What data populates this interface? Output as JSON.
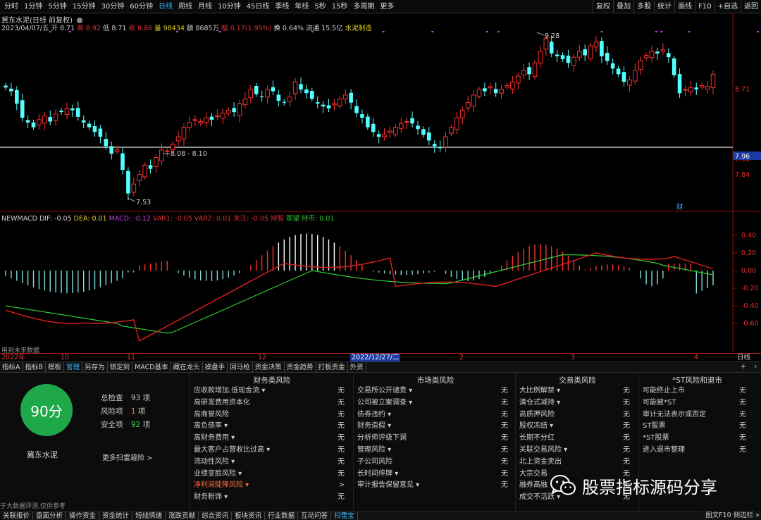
{
  "toolbar": {
    "tabs": [
      "分时",
      "1分钟",
      "5分钟",
      "15分钟",
      "30分钟",
      "60分钟",
      "日线",
      "周线",
      "月线",
      "10分钟",
      "45日线",
      "季线",
      "年线",
      "5秒",
      "15秒",
      "多周期",
      "更多"
    ],
    "active_tab": "日线",
    "right": [
      "复权",
      "叠加",
      "多股",
      "统计",
      "画线",
      "F10",
      "+自选",
      "返回"
    ]
  },
  "header": {
    "title": "冀东水泥(日线 前复权)",
    "date": "2023/04/07/五",
    "open_label": "开",
    "open": "8.71",
    "high_label": "高",
    "high": "8.92",
    "low_label": "低",
    "low": "8.71",
    "close_label": "收",
    "close": "8.86",
    "volume_label": "量",
    "volume": "98434",
    "amount_label": "额",
    "amount": "8685万",
    "change_label": "幅",
    "change": "0.17(1.95%)",
    "turnover_label": "换",
    "turnover": "0.64%",
    "float_label": "流通",
    "float": "15.5亿",
    "industry": "水泥制造"
  },
  "kchart": {
    "price_labels": [
      "8.71",
      "7.96",
      "7.84"
    ],
    "current_price": "7.96",
    "high_mark": "9.28",
    "low_mark": "7.53",
    "range_mark": "8.08 - 8.10",
    "fin_marker": "财"
  },
  "macd": {
    "name": "NEWMACD",
    "dif_label": "DIF:",
    "dif": "-0.05",
    "dea_label": "DEA:",
    "dea": "0.01",
    "macd_label": "MACD:",
    "macd": "-0.12",
    "var1_label": "VAR1:",
    "var1": "-0.05",
    "var2_label": "VAR2:",
    "var2": "0.01",
    "focus_label": "关注:",
    "focus": "-0.05",
    "hold_label": "持股",
    "watch_label": "观望",
    "cash_label": "持币:",
    "cash": "0.01",
    "axis": [
      "0.40",
      "0.20",
      "0.00",
      "-0.20",
      "-0.40",
      "-0.60"
    ],
    "footnote": "用到未来数据"
  },
  "dateaxis": {
    "labels": [
      "2022年",
      "10",
      "11",
      "12",
      "2022/12/27/二",
      "2",
      "3",
      "4"
    ],
    "right_label": "日线"
  },
  "indicator_tabs": [
    "指标A",
    "指标B",
    "模板",
    "管理",
    "另存为",
    "锁定到",
    "MACD基本",
    "藏在龙头",
    "操盘手",
    "回马枪",
    "资金决策",
    "资金趋势",
    "打板资金",
    "外资"
  ],
  "indicator_active": "管理",
  "score": {
    "value": "90分",
    "total_label": "总检查",
    "total": "93",
    "total_unit": "项",
    "risk_label": "风险项",
    "risk": "1",
    "risk_unit": "项",
    "safe_label": "安全项",
    "safe": "92",
    "safe_unit": "项",
    "company": "冀东水泥",
    "more": "更多扫雷避险 >",
    "footnote": "于大数据评测,仅供参考",
    "color": "#1fa84a"
  },
  "risk_columns": [
    {
      "title": "财务类风险",
      "rows": [
        {
          "k": "应收款增加,低现金流 ▾",
          "v": "无"
        },
        {
          "k": "高研发费用资本化",
          "v": "无"
        },
        {
          "k": "高商誉风险",
          "v": "无"
        },
        {
          "k": "高负债率 ▾",
          "v": "无"
        },
        {
          "k": "高财务费用 ▾",
          "v": "无"
        },
        {
          "k": "最大客户占营收比过高 ▾",
          "v": "无"
        },
        {
          "k": "流动性风险 ▾",
          "v": "无"
        },
        {
          "k": "业绩变脸风险 ▾",
          "v": "无"
        },
        {
          "k": "净利润陡降风险 ▾",
          "v": ">",
          "warn": true
        },
        {
          "k": "财务粉饰 ▾",
          "v": "无"
        }
      ]
    },
    {
      "title": "市场类风险",
      "rows": [
        {
          "k": "交易所公开谴责 ▾",
          "v": "无"
        },
        {
          "k": "公司被立案调查 ▾",
          "v": "无"
        },
        {
          "k": "债券违约 ▾",
          "v": "无"
        },
        {
          "k": "财务造假 ▾",
          "v": "无"
        },
        {
          "k": "分析师评级下调",
          "v": "无"
        },
        {
          "k": "管理风险 ▾",
          "v": "无"
        },
        {
          "k": "子公司风险",
          "v": "无"
        },
        {
          "k": "长时间停牌 ▾",
          "v": "无"
        },
        {
          "k": "审计报告保留意见 ▾",
          "v": "无"
        }
      ]
    },
    {
      "title": "交易类风险",
      "rows": [
        {
          "k": "大比例解禁 ▾",
          "v": "无"
        },
        {
          "k": "清仓式减持 ▾",
          "v": "无"
        },
        {
          "k": "高质押风险",
          "v": "无"
        },
        {
          "k": "股权冻结 ▾",
          "v": "无"
        },
        {
          "k": "长期不分红",
          "v": "无"
        },
        {
          "k": "关联交易风险 ▾",
          "v": "无"
        },
        {
          "k": "北上资金卖出",
          "v": "无"
        },
        {
          "k": "大宗交易",
          "v": "无"
        },
        {
          "k": "融券高融",
          "v": "无"
        },
        {
          "k": "成交不活跃 ▾",
          "v": "无"
        }
      ]
    },
    {
      "title": "*ST风险和退市",
      "rows": [
        {
          "k": "可能终止上市",
          "v": "无"
        },
        {
          "k": "可能被*ST",
          "v": "无"
        },
        {
          "k": "审计无法表示或否定",
          "v": "无"
        },
        {
          "k": "ST股票",
          "v": "无"
        },
        {
          "k": "*ST股票",
          "v": "无"
        },
        {
          "k": "进入退市整理",
          "v": "无"
        }
      ]
    }
  ],
  "watermark": "股票指标源码分享",
  "bottom_tabs": [
    "关联报价",
    "盘面分析",
    "操作资金",
    "资金统计",
    "短线情绪",
    "涨跌贡献",
    "综合资讯",
    "板块资讯",
    "行业数据",
    "互动问答",
    "扫雷宝"
  ],
  "bottom_active": "扫雷宝",
  "bottom_right": "图文F10 侧边栏 »"
}
